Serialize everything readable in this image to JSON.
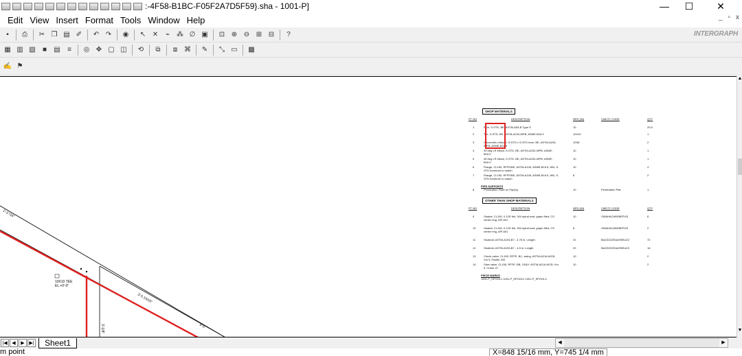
{
  "window": {
    "title": ":-4F58-B1BC-F05F2A7D5F59}.sha - 1001-P]",
    "minimize": "—",
    "maximize": "☐",
    "close": "✕"
  },
  "menu": [
    "Edit",
    "View",
    "Insert",
    "Format",
    "Tools",
    "Window",
    "Help"
  ],
  "mdi": {
    "minimize": "_",
    "restore": "▫",
    "close": "x"
  },
  "brand": "INTERGRAPH",
  "sheet": {
    "tab": "Sheet1"
  },
  "status": {
    "left": "m point",
    "coords": "X=848 15/16 mm, Y=745 1/4 mm"
  },
  "drawing": {
    "dim_top": "2'-1\"/16\"",
    "dim_mid": "3'-5 15/16\"",
    "dim_right": "9'-5",
    "dim_vert": "3'-1/8\"",
    "callout_line1": "10X10 TEE",
    "callout_line2": "EL +0'-0\""
  },
  "bom": {
    "shop_title": "SHOP MATERIALS",
    "col_pt": "PT NO",
    "col_desc": "DESCRIPTION",
    "col_npd": "NPD (IN)",
    "col_code": "CMDTY CODE",
    "col_qty": "QTY",
    "shop_rows": [
      {
        "pt": "1",
        "desc": "Pipe, S-STD, BE, ASTM-A53-B Type S",
        "npd": "10",
        "code": "",
        "qty": "20.5"
      },
      {
        "pt": "2",
        "desc": "Tee, S-STD, BE, ASTM-A234-WPB, ASME-B16.9",
        "npd": "10X10",
        "code": "",
        "qty": "1"
      },
      {
        "pt": "3",
        "desc": "Concentric reducer, S-STD x S-STD bore, BE, ASTM-A234-WPB, ASME-B16.9",
        "npd": "10X8",
        "code": "",
        "qty": "2"
      },
      {
        "pt": "4",
        "desc": "90 deg LR elbow, S-STD, BE, ASTM-A234-WPB, ASME-B16.9",
        "npd": "10",
        "code": "",
        "qty": "1"
      },
      {
        "pt": "5",
        "desc": "45 deg LR elbow, S-STD, BE, ASTM-A234-WPB, ASME-B16.9",
        "npd": "10",
        "code": "",
        "qty": "1"
      },
      {
        "pt": "6",
        "desc": "Flange, CL150, RFFE/BE, ASTM-A105, ASME-B16.5, WN, S-STD borebore to match",
        "npd": "10",
        "code": "",
        "qty": "4"
      },
      {
        "pt": "7",
        "desc": "Flange, CL150, RFFE/BE, ASTM-A105, ASME-B16.5, WN, S-STD borebore to match",
        "npd": "8",
        "code": "",
        "qty": "2"
      }
    ],
    "supports_title": "PIPE SUPPORTS",
    "support_rows": [
      {
        "pt": "8",
        "desc": "Penetration Plate on Pipe(s)",
        "npd": "10",
        "code": "Penetration Plat",
        "qty": "1"
      }
    ],
    "other_title": "OTHER THAN SHOP MATERIALS",
    "other_rows": [
      {
        "pt": "9",
        "desc": "Gasket, CL150, 0.125' thk, 304 spiral wnd, graph filed, CS center ring, API-601",
        "npd": "10",
        "code": "GMAHACABXBEPUS",
        "qty": "6"
      },
      {
        "pt": "10",
        "desc": "Gasket, CL150, 0.125' thk, 304 spiral wnd, graph filed, CS center ring, API-601",
        "npd": "8",
        "code": "GMAHACABXBEPUS",
        "qty": "2"
      },
      {
        "pt": "11",
        "desc": "Studbolt, ASTM-A193-B7 - 4.75 in. Length",
        "npd": "22",
        "code": "BAZZZZZEAAYBEUZZ",
        "qty": "72"
      },
      {
        "pt": "12",
        "desc": "Studbolt, ASTM-A193-B7 - 4.5 in. Length",
        "npd": "20",
        "code": "BAZZZZZEAAYBEUZZ",
        "qty": "16"
      },
      {
        "pt": "13",
        "desc": "Check valve, CL150, RFFE, BC, swing, ASTM-A216-WCB, Vm 5, Pacific 150",
        "npd": "10",
        "code": "",
        "qty": "2"
      },
      {
        "pt": "14",
        "desc": "Gate valve, CL150, RFFE, BB, OS&Y, ASTM-A216-WCB, Vm 5, Crane 47",
        "npd": "10",
        "code": "",
        "qty": "2"
      }
    ],
    "piece_title": "PIECE MARKS",
    "piece_marks": "1001-P_SPOOL1  1001-P_SPOOL2  1001-P_SPOOL3"
  },
  "colors": {
    "pipe_red": "#e02020",
    "highlight": "#e02020",
    "toolbar_bg": "#f0f0f0"
  }
}
